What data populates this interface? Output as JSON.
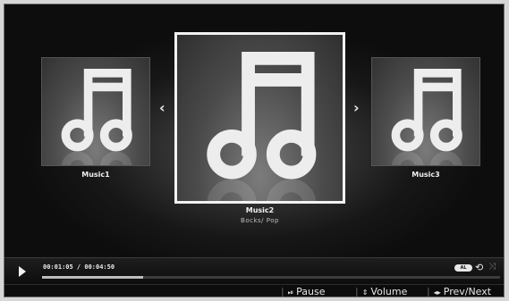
{
  "carousel": {
    "items": [
      {
        "title": "Music1",
        "genre": ""
      },
      {
        "title": "Music2",
        "genre": "Bocks/ Pop"
      },
      {
        "title": "Music3",
        "genre": ""
      }
    ],
    "prev_icon": "chevron-left-icon",
    "next_icon": "chevron-right-icon",
    "item_icon": "music-note-icon"
  },
  "player": {
    "time_display": "00:01:05 / 00:04:50",
    "progress": 0.22,
    "mode_badge": "AL",
    "repeat_icon": "repeat-icon",
    "shuffle_icon": "shuffle-icon"
  },
  "hints": [
    {
      "icon": "pause-key-icon",
      "label": "Pause"
    },
    {
      "icon": "up-down-key-icon",
      "label": "Volume"
    },
    {
      "icon": "left-right-key-icon",
      "label": "Prev/Next"
    }
  ],
  "colors": {
    "background": "#0c0c0c",
    "selection_border": "#f2f2f2",
    "text": "#e6e6e6"
  }
}
